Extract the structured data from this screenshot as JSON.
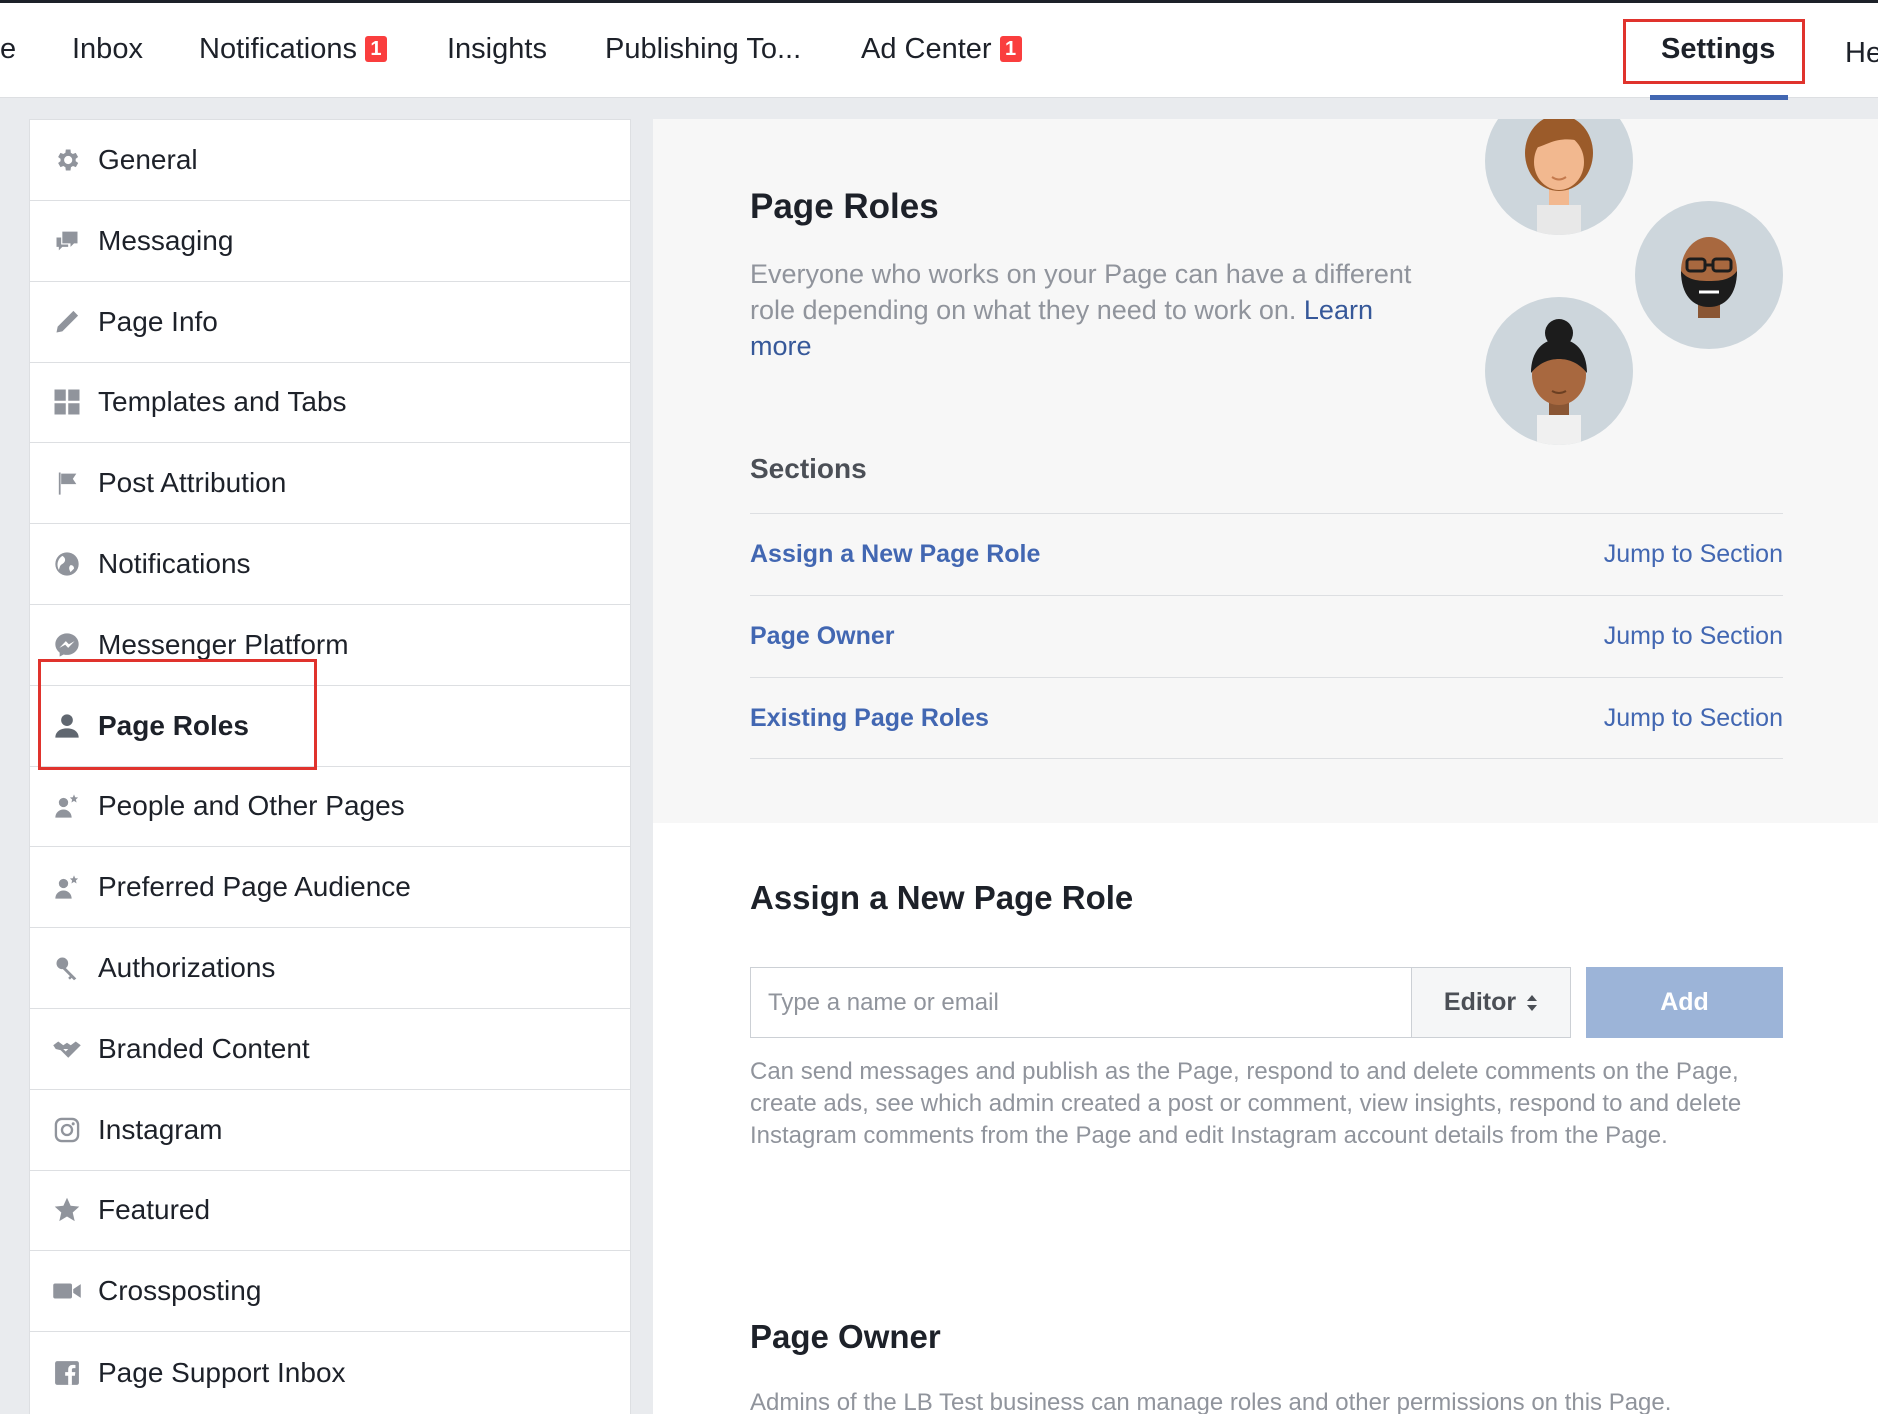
{
  "nav": {
    "items": [
      {
        "label": "e"
      },
      {
        "label": "Inbox"
      },
      {
        "label": "Notifications",
        "badge": "1"
      },
      {
        "label": "Insights"
      },
      {
        "label": "Publishing To..."
      },
      {
        "label": "Ad Center",
        "badge": "1"
      },
      {
        "label": "Settings",
        "active": true
      },
      {
        "label": "He"
      }
    ],
    "badge_color": "#fa3e3e",
    "active_underline_color": "#4267b2"
  },
  "sidebar": {
    "items": [
      {
        "label": "General",
        "icon": "gear-icon"
      },
      {
        "label": "Messaging",
        "icon": "chat-bubbles-icon"
      },
      {
        "label": "Page Info",
        "icon": "pencil-icon"
      },
      {
        "label": "Templates and Tabs",
        "icon": "grid-icon"
      },
      {
        "label": "Post Attribution",
        "icon": "flag-icon"
      },
      {
        "label": "Notifications",
        "icon": "globe-icon"
      },
      {
        "label": "Messenger Platform",
        "icon": "messenger-icon"
      },
      {
        "label": "Page Roles",
        "icon": "person-icon",
        "active": true
      },
      {
        "label": "People and Other Pages",
        "icon": "person-star-icon"
      },
      {
        "label": "Preferred Page Audience",
        "icon": "person-star-icon"
      },
      {
        "label": "Authorizations",
        "icon": "key-icon"
      },
      {
        "label": "Branded Content",
        "icon": "handshake-icon"
      },
      {
        "label": "Instagram",
        "icon": "instagram-icon"
      },
      {
        "label": "Featured",
        "icon": "star-icon"
      },
      {
        "label": "Crossposting",
        "icon": "video-camera-icon"
      },
      {
        "label": "Page Support Inbox",
        "icon": "facebook-icon"
      }
    ]
  },
  "page_roles": {
    "title": "Page Roles",
    "description": "Everyone who works on your Page can have a different role depending on what they need to work on.",
    "learn_more": "Learn more"
  },
  "sections": {
    "title": "Sections",
    "rows": [
      {
        "name": "Assign a New Page Role",
        "jump": "Jump to Section"
      },
      {
        "name": "Page Owner",
        "jump": "Jump to Section"
      },
      {
        "name": "Existing Page Roles",
        "jump": "Jump to Section"
      }
    ]
  },
  "assign": {
    "title": "Assign a New Page Role",
    "input_placeholder": "Type a name or email",
    "role_selected": "Editor",
    "add_label": "Add",
    "help_text": "Can send messages and publish as the Page, respond to and delete comments on the Page, create ads, see which admin created a post or comment, view insights, respond to and delete Instagram comments from the Page and edit Instagram account details from the Page."
  },
  "owner": {
    "title": "Page Owner",
    "text": "Admins of the LB Test business can manage roles and other permissions on this Page."
  },
  "colors": {
    "link": "#4267b2",
    "highlight_box": "#e0332d",
    "add_button": "#9cb4d8"
  }
}
